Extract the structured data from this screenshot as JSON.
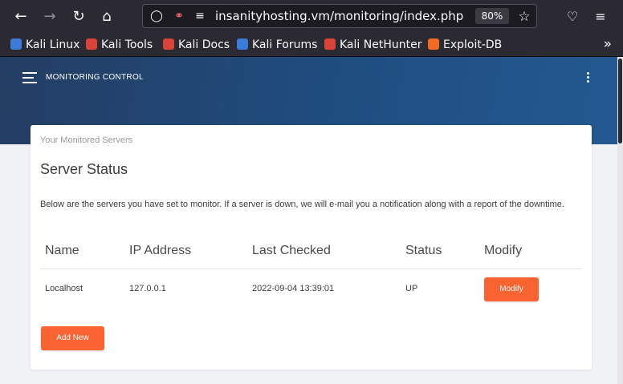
{
  "browser": {
    "url": "insanityhosting.vm/monitoring/index.php",
    "zoom": "80%",
    "bookmarks": [
      {
        "label": "Kali Linux",
        "color": "#3c7bd8"
      },
      {
        "label": "Kali Tools",
        "color": "#d9443a"
      },
      {
        "label": "Kali Docs",
        "color": "#d9443a"
      },
      {
        "label": "Kali Forums",
        "color": "#3c7bd8"
      },
      {
        "label": "Kali NetHunter",
        "color": "#d9443a"
      },
      {
        "label": "Exploit-DB",
        "color": "#f06a24"
      }
    ]
  },
  "header": {
    "brand": "MONITORING CONTROL"
  },
  "card": {
    "subtitle": "Your Monitored Servers",
    "title": "Server Status",
    "description": "Below are the servers you have set to monitor. If a server is down, we will e-mail you a notification along with a report of the downtime.",
    "columns": [
      "Name",
      "IP Address",
      "Last Checked",
      "Status",
      "Modify"
    ],
    "rows": [
      {
        "name": "Localhost",
        "ip": "127.0.0.1",
        "last_checked": "2022-09-04 13:39:01",
        "status": "UP",
        "modify_label": "Modify"
      }
    ],
    "add_label": "Add New"
  },
  "colors": {
    "accent": "#f96332",
    "header_bg": "#1f4d80"
  }
}
